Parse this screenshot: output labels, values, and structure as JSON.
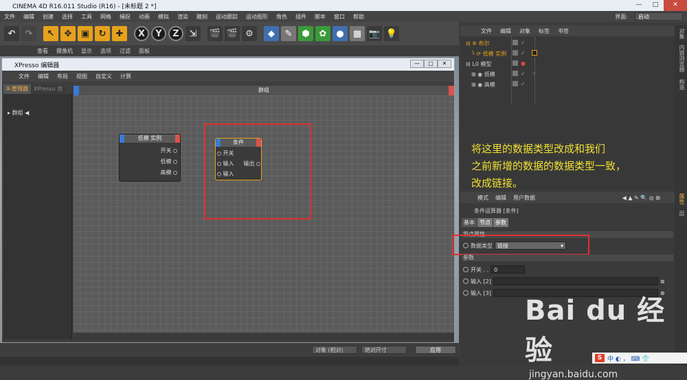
{
  "window": {
    "title": "CINEMA 4D R16.011 Studio (R16) - [未标题 2 *]",
    "min": "—",
    "max": "□",
    "close": "✕"
  },
  "menubar": {
    "items": [
      "文件",
      "编辑",
      "创建",
      "选择",
      "工具",
      "网格",
      "捕捉",
      "动画",
      "模拟",
      "渲染",
      "雕刻",
      "运动跟踪",
      "运动图形",
      "角色",
      "插件",
      "脚本",
      "窗口",
      "帮助"
    ],
    "layout_label": "界面:",
    "layout_value": "启动"
  },
  "viewport_menu": [
    "查看",
    "摄像机",
    "显示",
    "选项",
    "过滤",
    "面板"
  ],
  "xpresso": {
    "title": "XPresso 编辑器",
    "menu": [
      "文件",
      "编辑",
      "布局",
      "视图",
      "自定义",
      "计算"
    ],
    "tabs": [
      "X-管理器",
      "XPresso 池"
    ],
    "tree_item": "群组",
    "group_title": "群组",
    "node1": {
      "title": "低模 实例",
      "ports": [
        "开关",
        "低模",
        "高模"
      ]
    },
    "node2": {
      "title": "条件",
      "inputs": [
        "开关",
        "输入",
        "输入"
      ],
      "output": "输出"
    }
  },
  "object_manager": {
    "menu": [
      "文件",
      "编辑",
      "对象",
      "标签",
      "书签"
    ],
    "rows": [
      {
        "name": "布尔",
        "color": "#e6a21c"
      },
      {
        "name": "低模 实例",
        "color": "#e6a21c"
      },
      {
        "name": "模型",
        "color": "#dddddd"
      },
      {
        "name": "低模",
        "color": "#dddddd"
      },
      {
        "name": "高模",
        "color": "#dddddd"
      }
    ]
  },
  "annotation": {
    "lines": [
      "将这里的数据类型改成和我们",
      "之前新增的数据的数据类型一致，",
      "改成链接。"
    ]
  },
  "attributes": {
    "menu": [
      "模式",
      "编辑",
      "用户数据"
    ],
    "subtitle": "条件运算器 [条件]",
    "tabs": [
      "基本",
      "节点",
      "参数"
    ],
    "section_node": "节点属性",
    "datatype_label": "数据类型",
    "datatype_value": "链接",
    "section_params": "参数",
    "switch_label": "开关 . .",
    "switch_value": "0",
    "input2_label": "输入 [2]",
    "input3_label": "输入 [3]"
  },
  "right_strip": {
    "tabs": [
      "对象",
      "内容浏览器",
      "构造",
      "属性",
      "层"
    ]
  },
  "bottom": {
    "select1": "对象 (相对)",
    "select2": "绝对尺寸",
    "apply": "应用"
  },
  "watermark": {
    "logo": "Bai du 经验",
    "url": "jingyan.baidu.com"
  },
  "tray": {
    "s": "S",
    "text": "中 ◐ ， ⌨ 👕"
  }
}
